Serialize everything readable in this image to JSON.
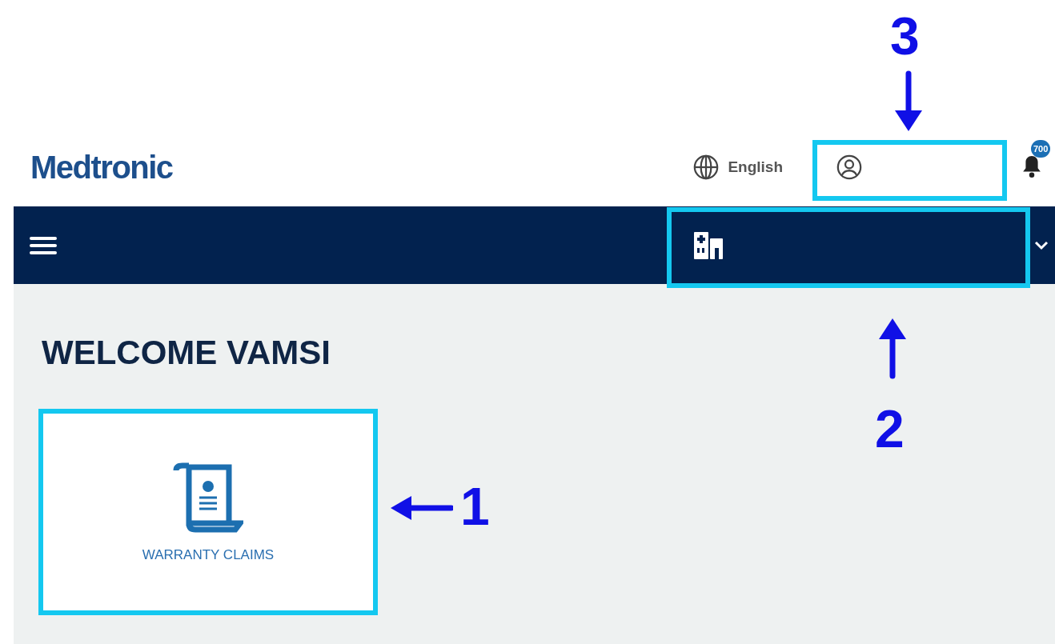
{
  "header": {
    "logo": "Medtronic",
    "language": "English",
    "notification_badge": "700"
  },
  "welcome": "WELCOME VAMSI",
  "tiles": [
    {
      "label": "WARRANTY CLAIMS",
      "highlighted": true
    }
  ],
  "annotations": [
    {
      "label": "1",
      "kind": "left"
    },
    {
      "label": "2",
      "kind": "up"
    },
    {
      "label": "3",
      "kind": "down"
    }
  ]
}
